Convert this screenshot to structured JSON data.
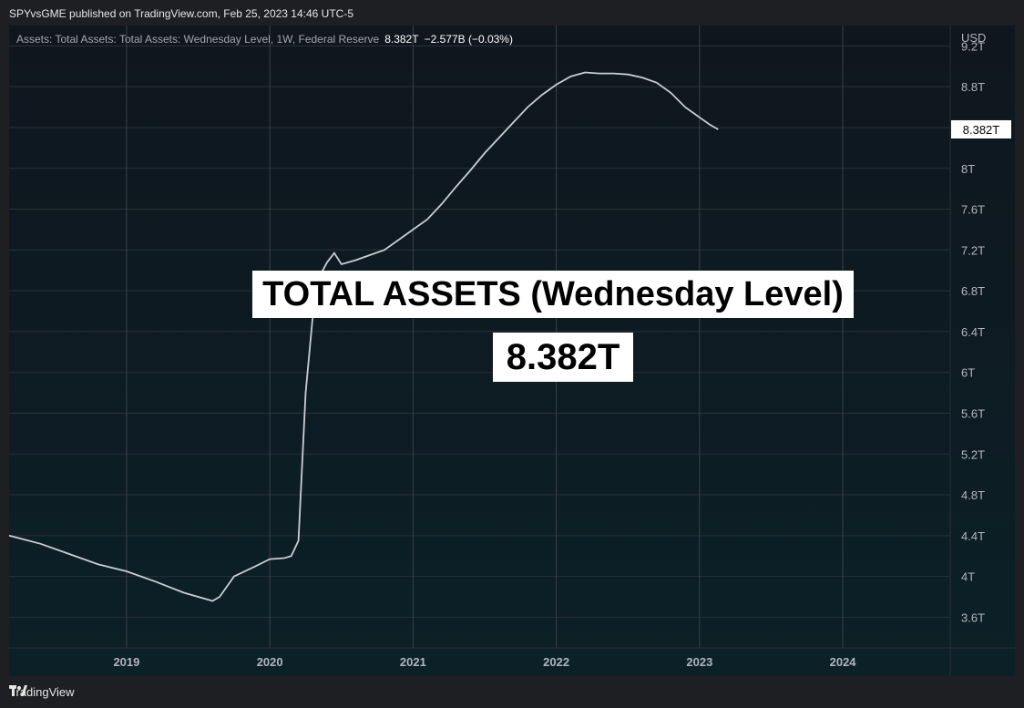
{
  "header": {
    "publish_line": "SPYvsGME published on TradingView.com, Feb 25, 2023 14:46 UTC-5"
  },
  "legend": {
    "title": "Assets: Total Assets: Total Assets: Wednesday Level, 1W, Federal Reserve",
    "last_value": "8.382T",
    "change": "−2.577B (−0.03%)"
  },
  "overlay": {
    "title": "TOTAL ASSETS (Wednesday Level)",
    "value": "8.382T"
  },
  "footer": {
    "brand": "TradingView",
    "logo_icon": "tradingview-logo-icon"
  },
  "chart_data": {
    "type": "line",
    "currency_label": "USD",
    "last_value_label": "8.382T",
    "ylim": [
      3.3,
      9.4
    ],
    "xlim": [
      2018.18,
      2024.75
    ],
    "y_ticks": [
      {
        "v": 3.6,
        "label": "3.6T"
      },
      {
        "v": 4.0,
        "label": "4T"
      },
      {
        "v": 4.4,
        "label": "4.4T"
      },
      {
        "v": 4.8,
        "label": "4.8T"
      },
      {
        "v": 5.2,
        "label": "5.2T"
      },
      {
        "v": 5.6,
        "label": "5.6T"
      },
      {
        "v": 6.0,
        "label": "6T"
      },
      {
        "v": 6.4,
        "label": "6.4T"
      },
      {
        "v": 6.8,
        "label": "6.8T"
      },
      {
        "v": 7.2,
        "label": "7.2T"
      },
      {
        "v": 7.6,
        "label": "7.6T"
      },
      {
        "v": 8.0,
        "label": "8T"
      },
      {
        "v": 8.4,
        "label": ""
      },
      {
        "v": 8.8,
        "label": "8.8T"
      },
      {
        "v": 9.2,
        "label": "9.2T"
      }
    ],
    "x_ticks": [
      {
        "v": 2019,
        "label": "2019"
      },
      {
        "v": 2020,
        "label": "2020"
      },
      {
        "v": 2021,
        "label": "2021"
      },
      {
        "v": 2022,
        "label": "2022"
      },
      {
        "v": 2023,
        "label": "2023"
      },
      {
        "v": 2024,
        "label": "2024"
      }
    ],
    "grid": true,
    "line_color": "#c9cdd4",
    "series": [
      {
        "x": [
          2018.18,
          2018.4,
          2018.6,
          2018.8,
          2019.0,
          2019.2,
          2019.4,
          2019.6,
          2019.65,
          2019.75,
          2019.9,
          2020.0,
          2020.1,
          2020.15,
          2020.2,
          2020.25,
          2020.3,
          2020.35,
          2020.4,
          2020.45,
          2020.5,
          2020.6,
          2020.7,
          2020.8,
          2020.9,
          2021.0,
          2021.1,
          2021.2,
          2021.3,
          2021.4,
          2021.5,
          2021.6,
          2021.7,
          2021.8,
          2021.9,
          2022.0,
          2022.1,
          2022.2,
          2022.3,
          2022.4,
          2022.5,
          2022.6,
          2022.7,
          2022.8,
          2022.9,
          2023.0,
          2023.07,
          2023.13
        ],
        "y": [
          4.4,
          4.32,
          4.22,
          4.12,
          4.05,
          3.95,
          3.84,
          3.76,
          3.8,
          4.0,
          4.1,
          4.17,
          4.18,
          4.2,
          4.35,
          5.8,
          6.55,
          6.95,
          7.08,
          7.17,
          7.06,
          7.1,
          7.15,
          7.2,
          7.3,
          7.4,
          7.5,
          7.65,
          7.82,
          7.98,
          8.15,
          8.3,
          8.45,
          8.6,
          8.72,
          8.82,
          8.9,
          8.94,
          8.93,
          8.93,
          8.92,
          8.89,
          8.84,
          8.74,
          8.6,
          8.5,
          8.43,
          8.382
        ]
      }
    ]
  }
}
